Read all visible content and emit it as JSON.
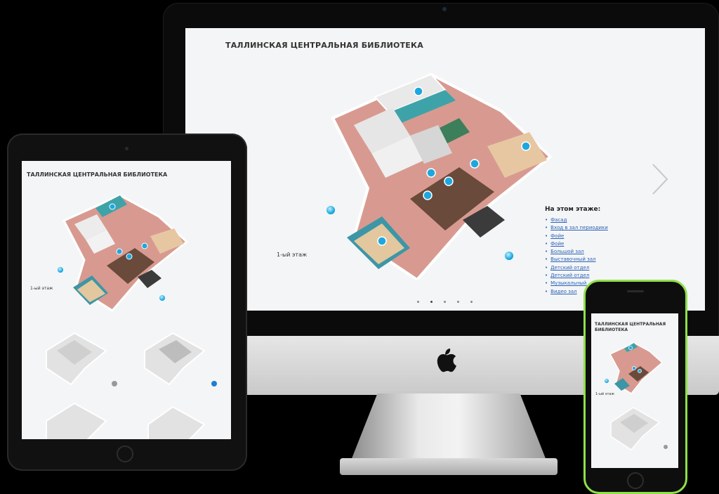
{
  "site": {
    "title": "ТАЛЛИНСКАЯ ЦЕНТРАЛЬНАЯ БИБЛИОТЕКА",
    "floor_label": "1-ый этаж",
    "side_heading": "На этом этаже:",
    "side_links": [
      "Фасад",
      "Вход в зал периодики",
      "Фойе",
      "Фойе",
      "Большой зал",
      "Выставочный зал",
      "Детский отдел",
      "Детский отдел",
      "Музыкальный ...",
      "Видео зал"
    ]
  },
  "colors": {
    "screen_bg": "#f4f5f6",
    "accent_blue": "#1ea7de",
    "link": "#2b62b8",
    "iphone_frame": "#8fe04a",
    "wall_red": "#c96b63"
  },
  "icons": [
    "apple-logo-icon",
    "chevron-right-icon",
    "info-pin-icon",
    "home-button-icon"
  ]
}
